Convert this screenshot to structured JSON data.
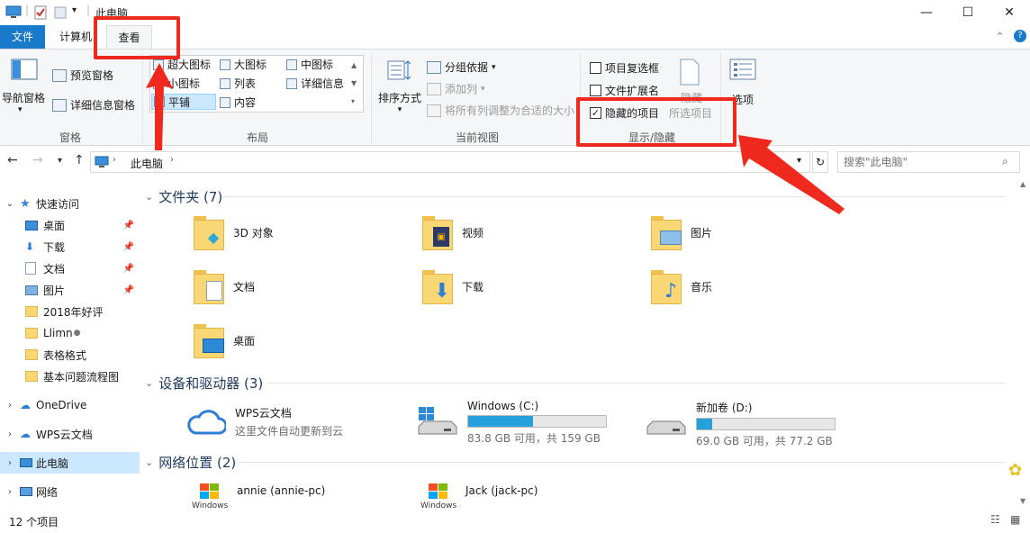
{
  "window": {
    "title": "此电脑",
    "minimize_glyph": "—",
    "maximize_glyph": "☐",
    "close_glyph": "✕"
  },
  "ribbon_tabs": [
    {
      "label": "文件"
    },
    {
      "label": "计算机"
    },
    {
      "label": "查看"
    }
  ],
  "ribbon": {
    "pane_group": {
      "nav_pane": "导航窗格",
      "preview_pane": "预览窗格",
      "details_pane": "详细信息窗格",
      "label": "窗格"
    },
    "layout_group": {
      "items": [
        "超大图标",
        "大图标",
        "中图标",
        "小图标",
        "列表",
        "详细信息",
        "平铺",
        "内容"
      ],
      "label": "布局"
    },
    "current_view_group": {
      "sort_by": "排序方式",
      "group_by": "分组依据",
      "add_column": "添加列",
      "fit_columns": "将所有列调整为合适的大小",
      "label": "当前视图"
    },
    "show_hide_group": {
      "item_checkboxes": "项目复选框",
      "file_extensions": "文件扩展名",
      "hidden_items": "隐藏的项目",
      "hide_selected": "隐藏",
      "selected_items": "所选项目",
      "label": "显示/隐藏",
      "item_checkboxes_checked": false,
      "file_extensions_checked": false,
      "hidden_items_checked": true
    },
    "options_label": "选项"
  },
  "address": {
    "path": "此电脑",
    "search_placeholder": "搜索\"此电脑\""
  },
  "sidebar": {
    "quick_access": "快速访问",
    "quick_items": [
      {
        "label": "桌面",
        "pinned": true
      },
      {
        "label": "下载",
        "pinned": true
      },
      {
        "label": "文档",
        "pinned": true
      },
      {
        "label": "图片",
        "pinned": true
      },
      {
        "label": "2018年好评",
        "pinned": false
      },
      {
        "label": "Llimn",
        "pinned": false
      },
      {
        "label": "表格格式",
        "pinned": false
      },
      {
        "label": "基本问题流程图",
        "pinned": false
      }
    ],
    "onedrive": "OneDrive",
    "wps": "WPS云文档",
    "this_pc": "此电脑",
    "network": "网络"
  },
  "content": {
    "folders_header": "文件夹 (7)",
    "folders": [
      "3D 对象",
      "视频",
      "图片",
      "文档",
      "下载",
      "音乐",
      "桌面"
    ],
    "devices_header": "设备和驱动器 (3)",
    "wps_title": "WPS云文档",
    "wps_sub": "这里文件自动更新到云",
    "drive_c": {
      "name": "Windows (C:)",
      "space": "83.8 GB 可用，共 159 GB",
      "used_fraction": 0.47
    },
    "drive_d": {
      "name": "新加卷 (D:)",
      "space": "69.0 GB 可用，共 77.2 GB",
      "used_fraction": 0.11
    },
    "network_header": "网络位置 (2)",
    "network_items": [
      {
        "name": "annie (annie-pc)",
        "os": "Windows"
      },
      {
        "name": "Jack (jack-pc)",
        "os": "Windows"
      }
    ]
  },
  "status": {
    "count": "12 个项目"
  },
  "colors": {
    "accent": "#1979ca",
    "annotation": "#f0291f",
    "selection": "#cce8ff",
    "drive_fill": "#26a0da"
  }
}
